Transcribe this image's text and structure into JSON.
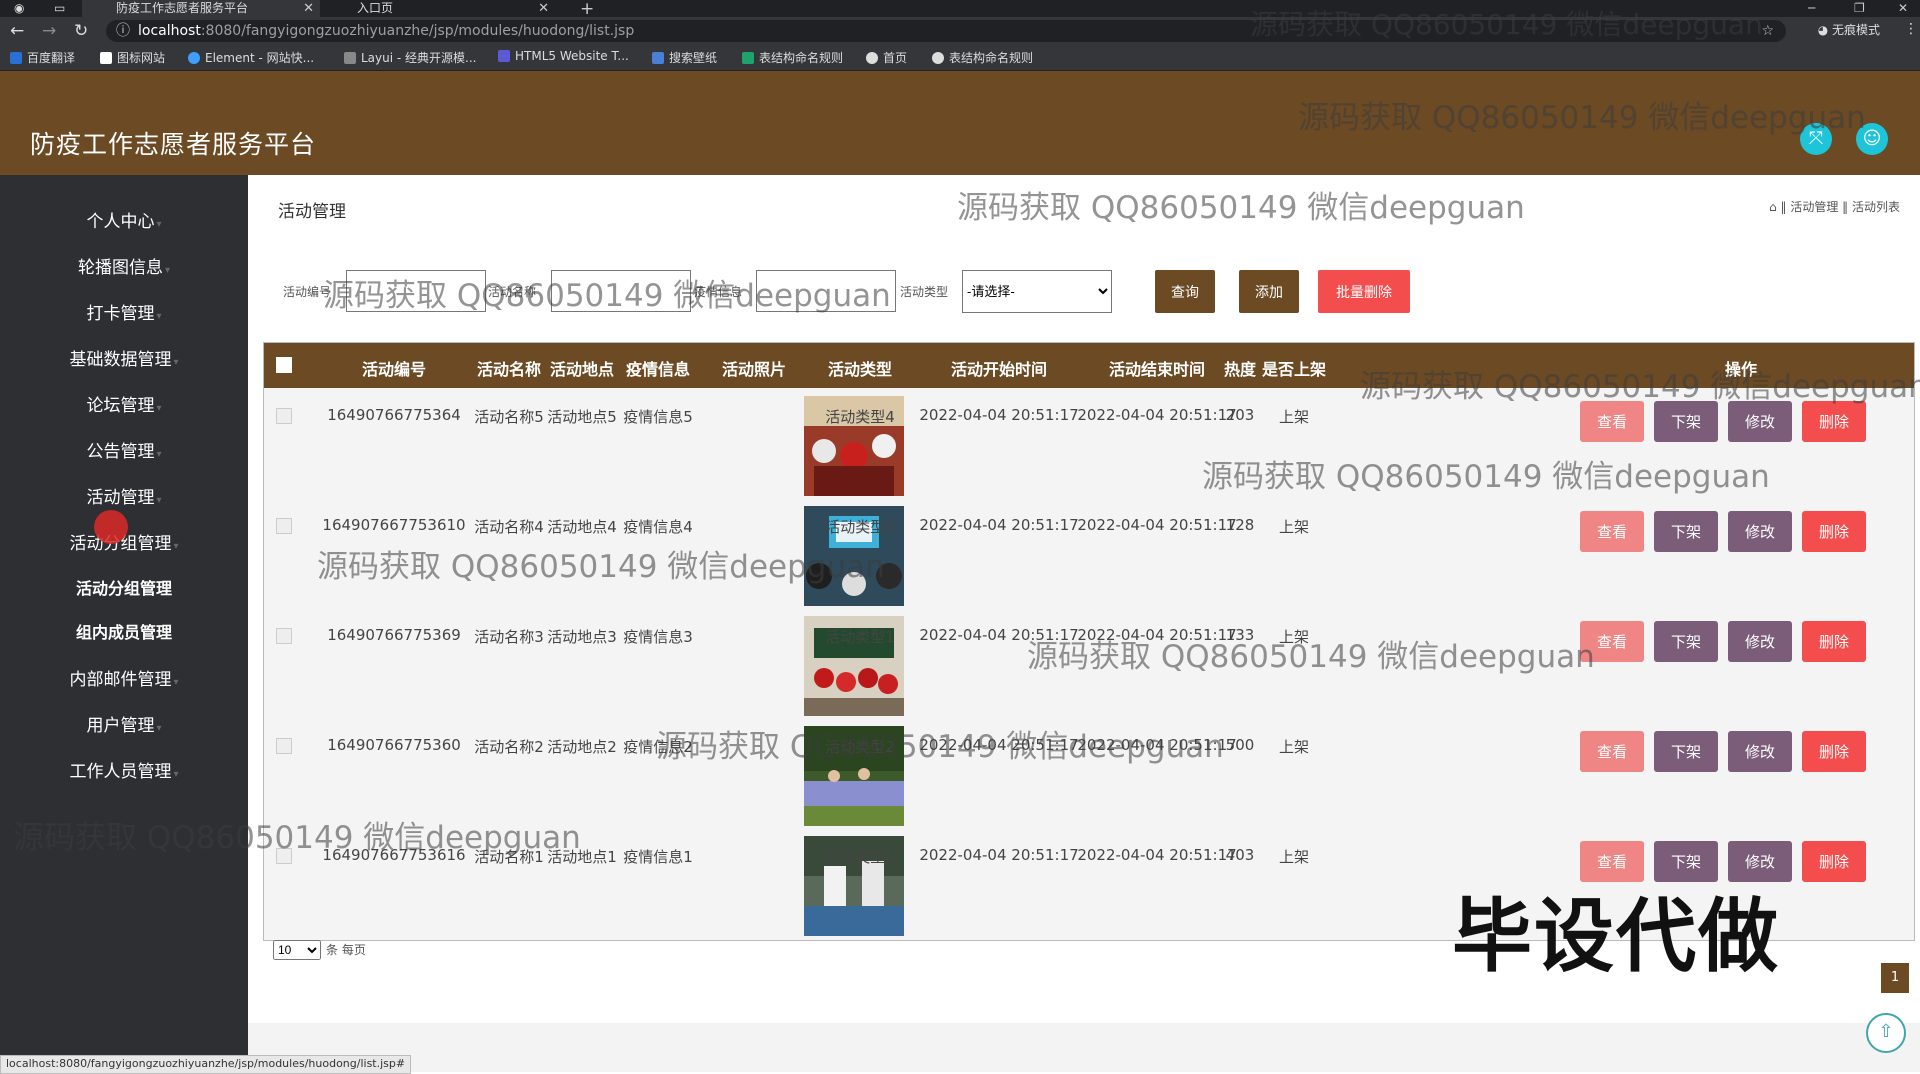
{
  "browser": {
    "tabs": [
      {
        "label": "防疫工作志愿者服务平台",
        "active": true
      },
      {
        "label": "入口页",
        "active": false
      }
    ],
    "url_host": "localhost",
    "url_path": ":8080/fangyigongzuozhiyuanzhe/jsp/modules/huodong/list.jsp",
    "incognito_label": "无痕模式",
    "bookmarks": [
      "百度翻译",
      "图标网站",
      "Element - 网站快...",
      "Layui - 经典开源模...",
      "HTML5 Website T...",
      "搜索壁纸",
      "表结构命名规则",
      "首页",
      "表结构命名规则"
    ],
    "status_url": "localhost:8080/fangyigongzuozhiyuanzhe/jsp/modules/huodong/list.jsp#"
  },
  "app": {
    "title": "防疫工作志愿者服务平台"
  },
  "colors": {
    "brand": "#6b4a24",
    "sidebar": "#2e2f33",
    "accent": "#1ec5d8",
    "delete": "#f44d4d"
  },
  "sidebar": {
    "items": [
      {
        "label": "个人中心"
      },
      {
        "label": "轮播图信息"
      },
      {
        "label": "打卡管理"
      },
      {
        "label": "基础数据管理"
      },
      {
        "label": "论坛管理"
      },
      {
        "label": "公告管理"
      },
      {
        "label": "活动管理"
      },
      {
        "label": "活动分组管理"
      },
      {
        "label": "活动分组管理"
      },
      {
        "label": "组内成员管理"
      },
      {
        "label": "内部邮件管理"
      },
      {
        "label": "用户管理"
      },
      {
        "label": "工作人员管理"
      }
    ]
  },
  "main": {
    "page_title": "活动管理",
    "breadcrumb": [
      "活动管理",
      "活动列表"
    ],
    "filters": {
      "labels": [
        "活动编号",
        "活动名称",
        "疫情信息",
        "活动类型"
      ],
      "select_value": "-请选择-"
    },
    "buttons": {
      "search": "查询",
      "add": "添加",
      "batch_delete": "批量删除"
    },
    "table": {
      "headers": [
        "活动编号",
        "活动名称",
        "活动地点",
        "疫情信息",
        "活动照片",
        "活动类型",
        "活动开始时间",
        "活动结束时间",
        "热度",
        "是否上架",
        "操作"
      ],
      "actions": {
        "view": "查看",
        "off": "下架",
        "edit": "修改",
        "delete": "删除"
      },
      "rows": [
        {
          "id": "16490766775364",
          "name": "活动名称5",
          "place": "活动地点5",
          "info": "疫情信息5",
          "type": "活动类型4",
          "start": "2022-04-04 20:51:17",
          "end": "2022-04-04 20:51:17",
          "heat": "203",
          "status": "上架"
        },
        {
          "id": "164907667753610",
          "name": "活动名称4",
          "place": "活动地点4",
          "info": "疫情信息4",
          "type": "活动类型3",
          "start": "2022-04-04 20:51:17",
          "end": "2022-04-04 20:51:17",
          "heat": "128",
          "status": "上架"
        },
        {
          "id": "16490766775369",
          "name": "活动名称3",
          "place": "活动地点3",
          "info": "疫情信息3",
          "type": "活动类型1",
          "start": "2022-04-04 20:51:17",
          "end": "2022-04-04 20:51:17",
          "heat": "133",
          "status": "上架"
        },
        {
          "id": "16490766775360",
          "name": "活动名称2",
          "place": "活动地点2",
          "info": "疫情信息2",
          "type": "活动类型2",
          "start": "2022-04-04 20:51:17",
          "end": "2022-04-04 20:51:17",
          "heat": "500",
          "status": "上架"
        },
        {
          "id": "164907667753616",
          "name": "活动名称1",
          "place": "活动地点1",
          "info": "疫情信息1",
          "type": "活动类型4",
          "start": "2022-04-04 20:51:17",
          "end": "2022-04-04 20:51:17",
          "heat": "403",
          "status": "上架"
        }
      ]
    },
    "pager": {
      "page_size": "10",
      "per_page_label": "条 每页",
      "current_page": "1"
    }
  },
  "watermarks": {
    "text": "源码获取 QQ86050149 微信deepguan",
    "big": "毕设代做"
  }
}
